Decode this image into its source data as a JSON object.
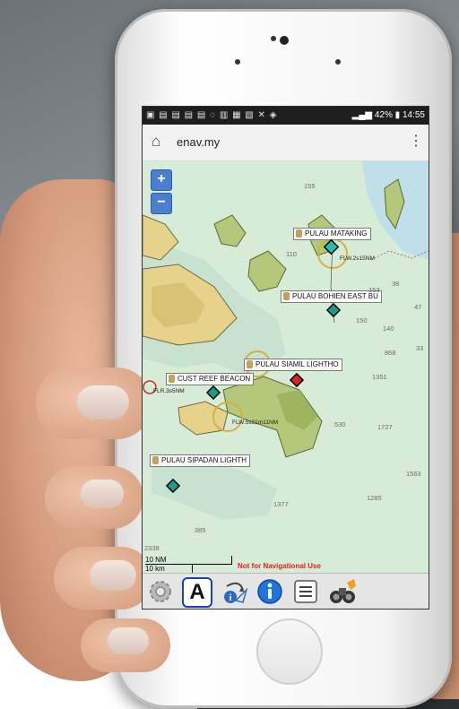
{
  "status_bar": {
    "battery": "42%",
    "time": "14:55"
  },
  "browser": {
    "url": "enav.my"
  },
  "map": {
    "zoom_in": "+",
    "zoom_out": "−",
    "labels": [
      "PULAU MATAKING",
      "PULAU BOHIEN EAST BU",
      "PULAU SIAMIL LIGHTHO",
      "CUST REEF BEACON",
      "PULAU SIPADAN LIGHTH"
    ],
    "light_characteristics": [
      "FLW.2s15NM",
      "FLR.3s5NM",
      "FLW.5s31m11NM"
    ],
    "depths": [
      "155",
      "110",
      "153",
      "150",
      "140",
      "868",
      "1351",
      "530",
      "1727",
      "1563",
      "1285",
      "1377",
      "385",
      "2338",
      "38",
      "47",
      "33"
    ],
    "scale": {
      "nm": "10 NM",
      "km": "10 km"
    },
    "notice": "Not for Navigational Use"
  },
  "toolbar": {
    "tools": [
      "gear-icon",
      "text-a-icon",
      "route-info-icon",
      "info-icon",
      "list-icon",
      "binoculars-icon"
    ],
    "text_tool_letter": "A",
    "info_letter": "i"
  }
}
